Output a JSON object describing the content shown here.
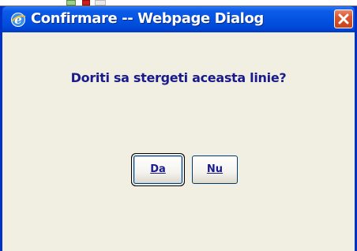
{
  "dialog": {
    "title": "Confirmare -- Webpage Dialog",
    "message": "Doriti sa stergeti aceasta linie?",
    "buttons": {
      "yes_label": "Da",
      "no_label": "Nu"
    },
    "icons": {
      "title_icon": "internet-explorer-icon",
      "close_icon": "close-icon"
    },
    "colors": {
      "titlebar": "#0654e3",
      "client_background": "#f1efe2",
      "message_text": "#1a1a8c",
      "close_button": "#d8552e"
    }
  }
}
